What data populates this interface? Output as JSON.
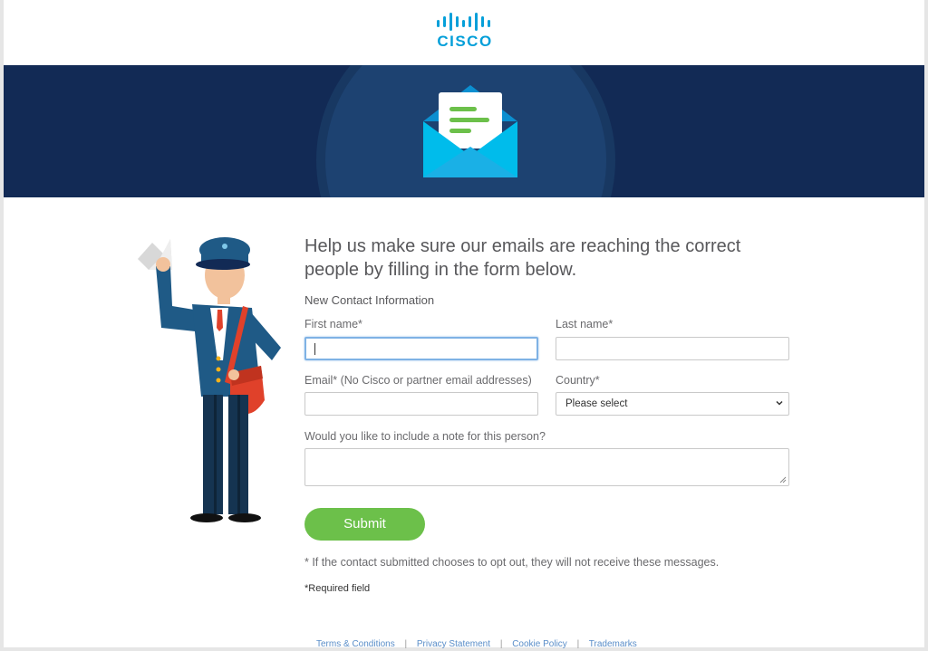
{
  "brand": {
    "name": "CISCO",
    "logo_color": "#049fd9"
  },
  "banner": {
    "background": "#122a55",
    "icon": "envelope-icon"
  },
  "form": {
    "heading": "Help us make sure our emails are reaching the correct people by filling in the form below.",
    "subheading": "New Contact Information",
    "first_name_label": "First name*",
    "first_name_value": "",
    "last_name_label": "Last name*",
    "last_name_value": "",
    "email_label": "Email* (No Cisco or partner email addresses)",
    "email_value": "",
    "country_label": "Country*",
    "country_selected": "Please select",
    "note_label": "Would you like to include a note for this person?",
    "note_value": "",
    "submit_label": "Submit",
    "submit_color": "#6cc04a",
    "opt_out_note": "* If the contact submitted chooses to opt out, they will not receive these messages.",
    "required_note": "*Required field"
  },
  "footer": {
    "links": [
      "Terms & Conditions",
      "Privacy Statement",
      "Cookie Policy",
      "Trademarks"
    ],
    "separator": "|"
  }
}
